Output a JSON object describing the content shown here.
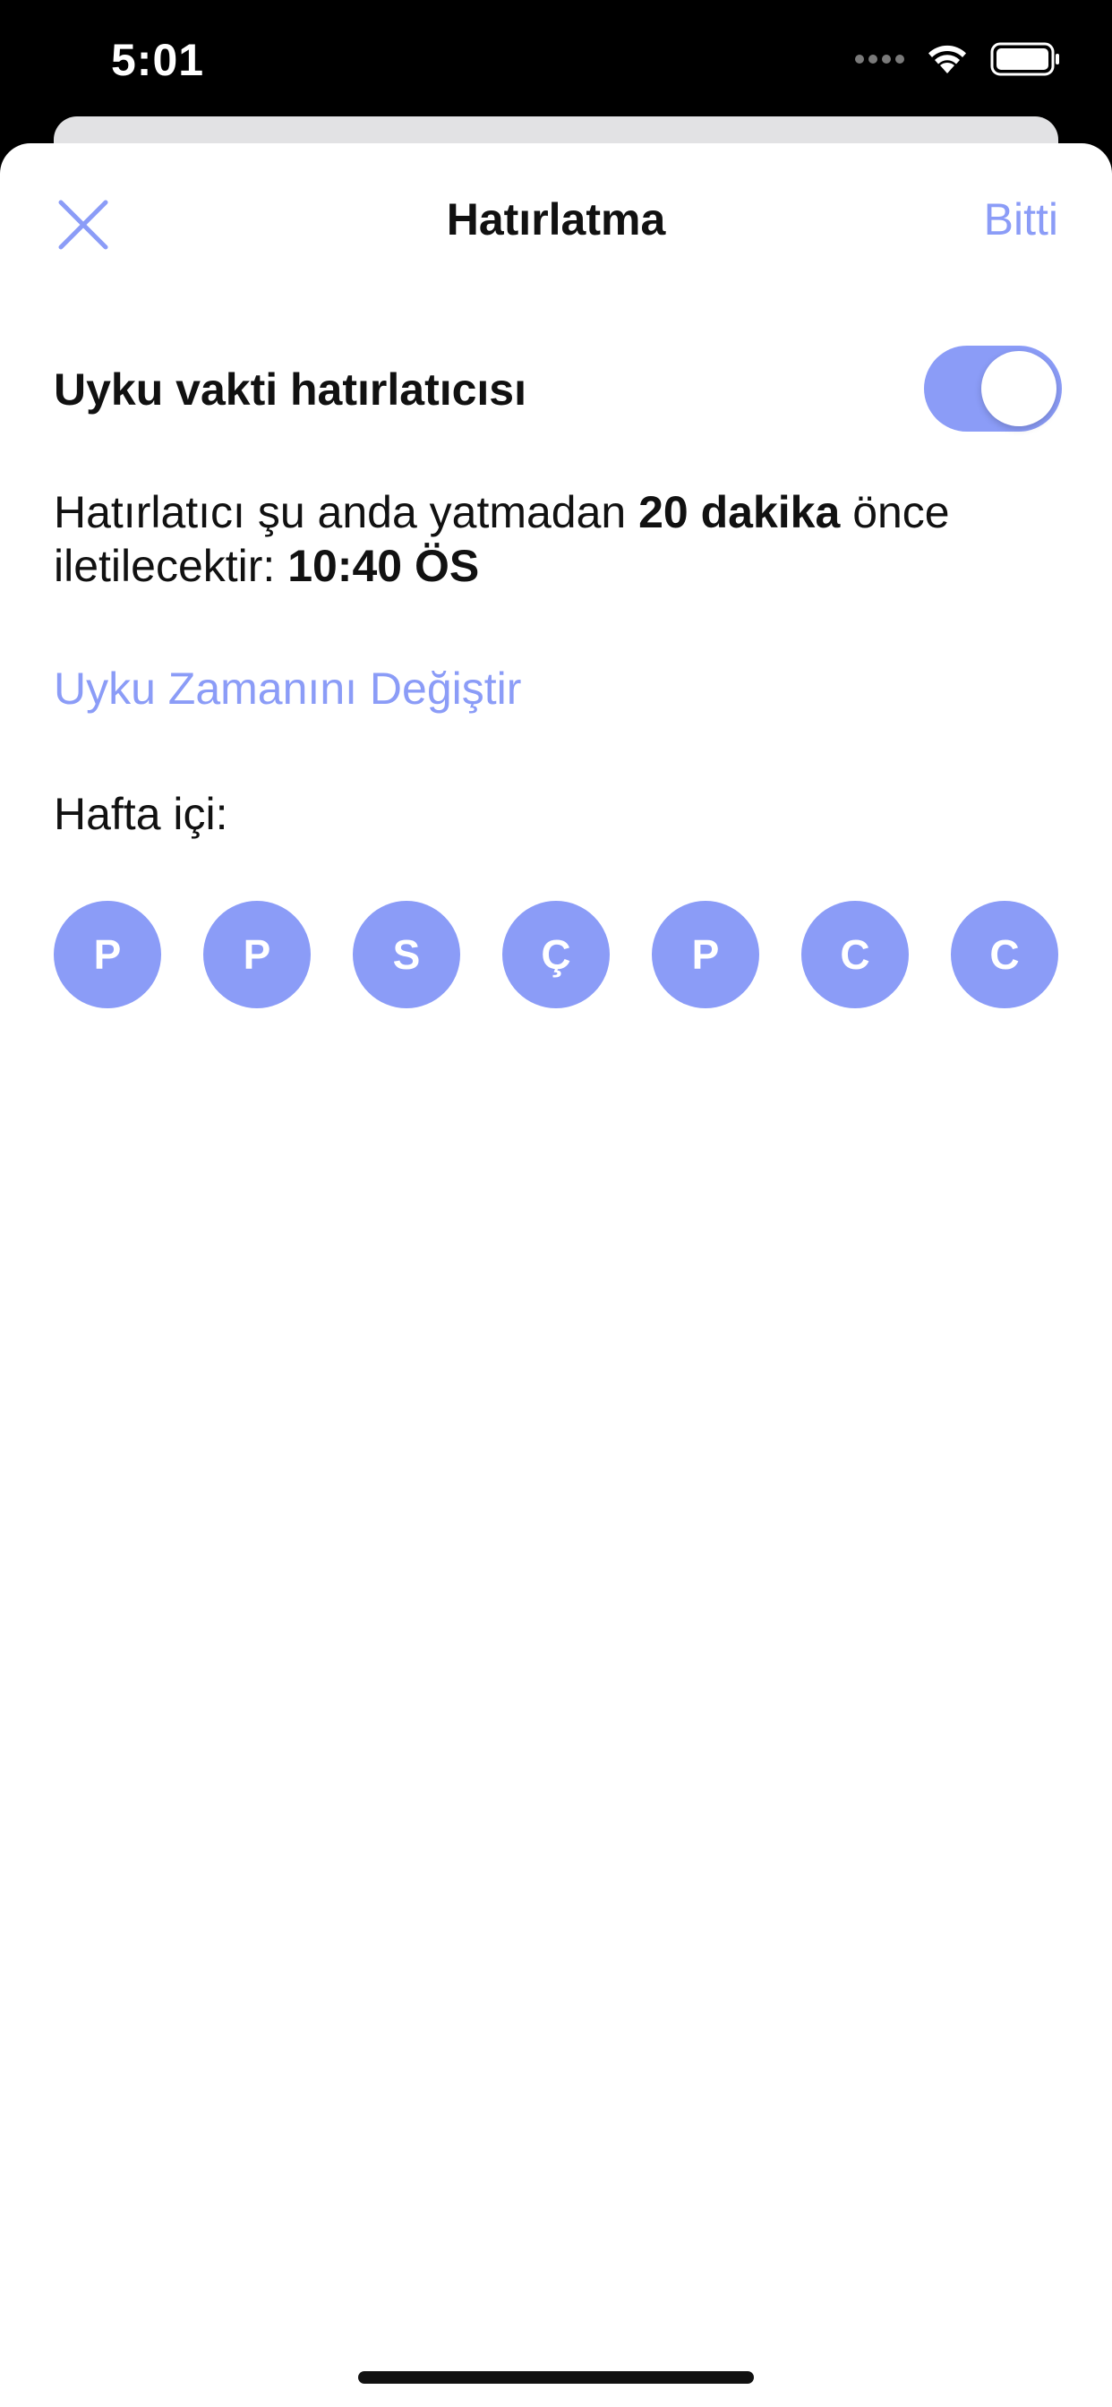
{
  "status_bar": {
    "time": "5:01",
    "icons": [
      "signal-dots-icon",
      "wifi-icon",
      "battery-icon"
    ]
  },
  "nav": {
    "title": "Hatırlatma",
    "done_label": "Bitti",
    "close_icon": "close-icon"
  },
  "reminder": {
    "toggle_label": "Uyku vakti hatırlatıcısı",
    "toggle_on": true,
    "info_prefix": "Hatırlatıcı şu anda yatmadan ",
    "info_minutes": "20 dakika",
    "info_middle": " önce iletilecektir: ",
    "info_time": "10:40 ÖS",
    "change_link": "Uyku Zamanını Değiştir"
  },
  "weekdays": {
    "label": "Hafta içi:",
    "days": [
      "P",
      "P",
      "S",
      "Ç",
      "P",
      "C",
      "C"
    ]
  },
  "colors": {
    "accent": "#8b9cf7",
    "text": "#111111",
    "background": "#ffffff"
  }
}
